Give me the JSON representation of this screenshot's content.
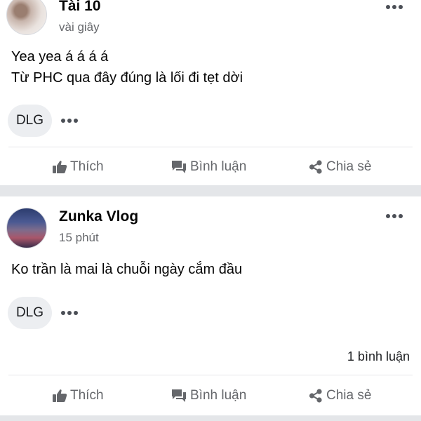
{
  "posts": [
    {
      "author": "Tài 10",
      "time": "vài giây",
      "body": [
        "Yea yea á á á á",
        "Từ PHC qua đây đúng là lối đi tẹt dời"
      ],
      "tag": "DLG",
      "comment_count": ""
    },
    {
      "author": "Zunka Vlog",
      "time": "15 phút",
      "body": [
        "Ko trần là mai là chuỗi ngày cắm đầu"
      ],
      "tag": "DLG",
      "comment_count": "1 bình luận"
    }
  ],
  "actions": {
    "like_label": "Thích",
    "comment_label": "Bình luận",
    "share_label": "Chia sẻ"
  },
  "icons": {
    "like": "thumbs-up-icon",
    "comment": "speech-bubble-icon",
    "share": "share-icon",
    "more": "more-options-icon"
  },
  "colors": {
    "text_primary": "#050505",
    "text_secondary": "#65676b",
    "separator": "#e4e6e9",
    "chip_background": "#eceef1"
  }
}
